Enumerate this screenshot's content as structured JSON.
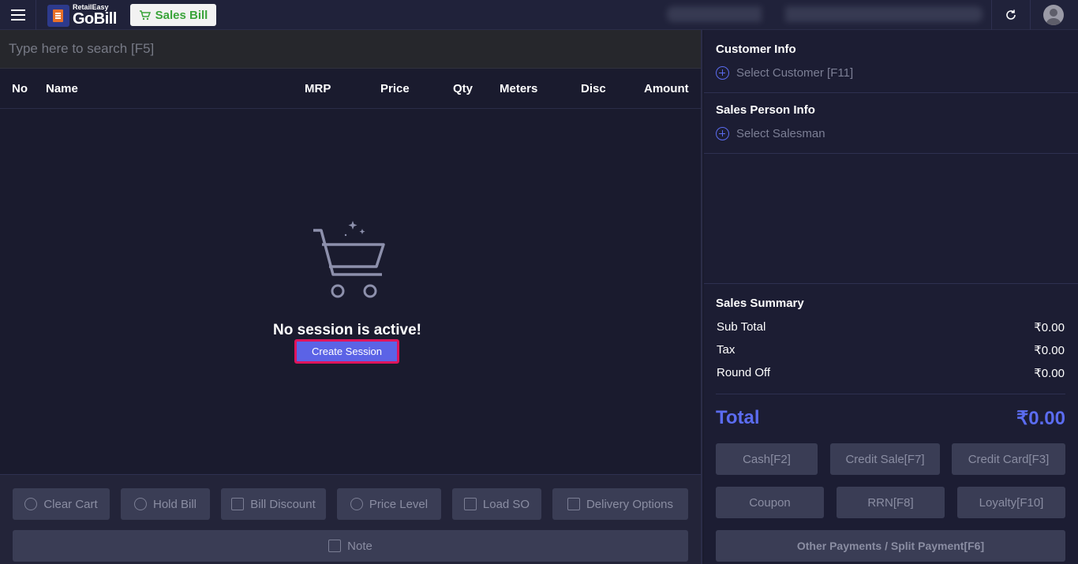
{
  "header": {
    "logo_small": "RetailEasy",
    "logo_big": "GoBill",
    "module_label": "Sales Bill"
  },
  "search": {
    "placeholder": "Type here to search [F5]"
  },
  "table": {
    "columns": [
      "No",
      "Name",
      "MRP",
      "Price",
      "Qty",
      "Meters",
      "Disc",
      "Amount"
    ]
  },
  "empty_state": {
    "message": "No session is active!",
    "create_label": "Create Session"
  },
  "actions": {
    "clear_cart": "Clear Cart",
    "hold_bill": "Hold Bill",
    "bill_discount": "Bill Discount",
    "price_level": "Price Level",
    "load_so": "Load SO",
    "delivery_options": "Delivery Options",
    "note": "Note"
  },
  "customer": {
    "title": "Customer Info",
    "select_label": "Select Customer [F11]"
  },
  "salesperson": {
    "title": "Sales Person Info",
    "select_label": "Select Salesman"
  },
  "summary": {
    "title": "Sales Summary",
    "subtotal_label": "Sub Total",
    "subtotal_value": "₹0.00",
    "tax_label": "Tax",
    "tax_value": "₹0.00",
    "roundoff_label": "Round Off",
    "roundoff_value": "₹0.00",
    "total_label": "Total",
    "total_value": "₹0.00"
  },
  "payments": {
    "cash": "Cash[F2]",
    "credit_sale": "Credit Sale[F7]",
    "credit_card": "Credit Card[F3]",
    "coupon": "Coupon",
    "rrn": "RRN[F8]",
    "loyalty": "Loyalty[F10]",
    "other": "Other Payments / Split Payment[F6]"
  },
  "colors": {
    "accent": "#5b6cf0",
    "create_button": "#5b63e6",
    "highlight_border": "#e0145c",
    "brand_green": "#3aa43a"
  }
}
